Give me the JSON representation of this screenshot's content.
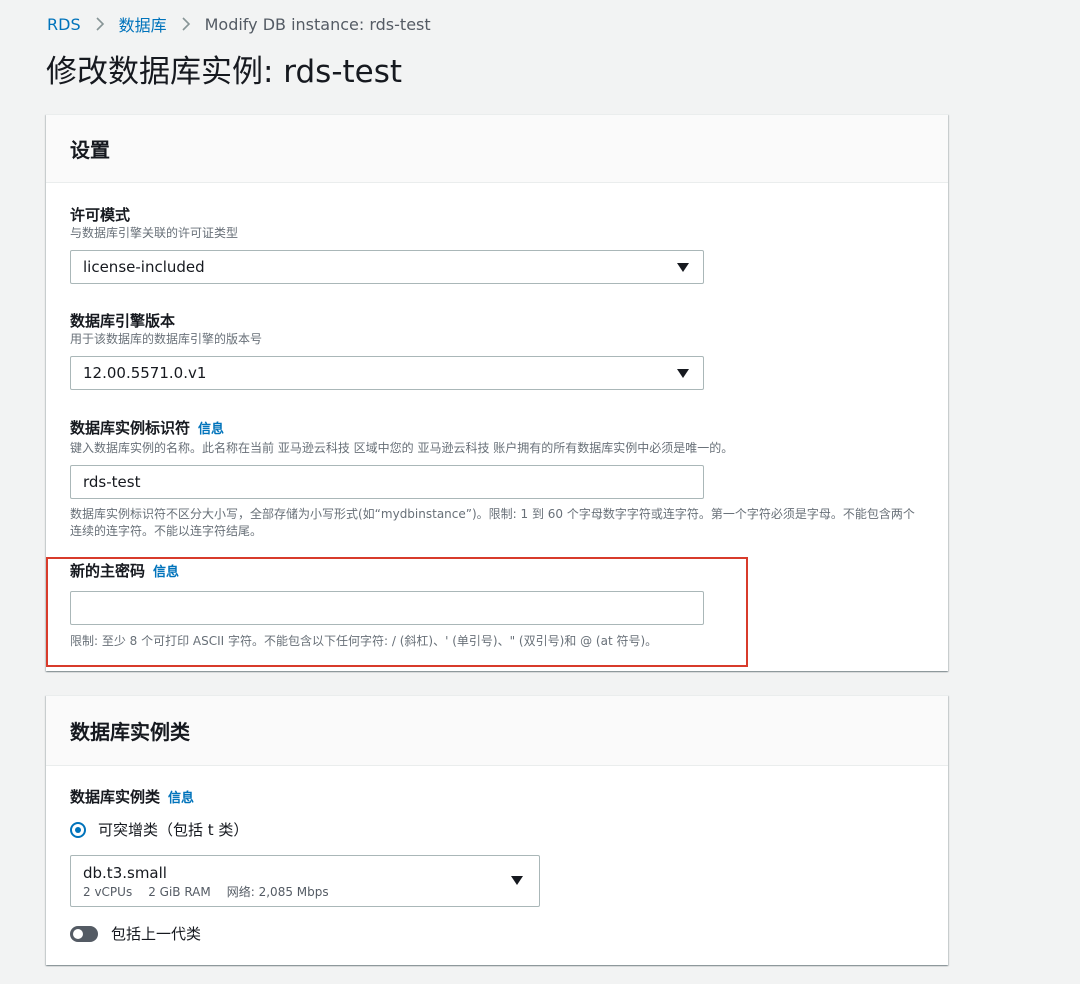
{
  "breadcrumb": {
    "items": [
      "RDS",
      "数据库"
    ],
    "current": "Modify DB instance: rds-test"
  },
  "page": {
    "title": "修改数据库实例: rds-test"
  },
  "settings": {
    "title": "设置",
    "license": {
      "label": "许可模式",
      "desc": "与数据库引擎关联的许可证类型",
      "value": "license-included"
    },
    "engine_version": {
      "label": "数据库引擎版本",
      "desc": "用于该数据库的数据库引擎的版本号",
      "value": "12.00.5571.0.v1"
    },
    "identifier": {
      "label": "数据库实例标识符",
      "info": "信息",
      "desc": "键入数据库实例的名称。此名称在当前 亚马逊云科技 区域中您的 亚马逊云科技 账户拥有的所有数据库实例中必须是唯一的。",
      "value": "rds-test",
      "constraint": "数据库实例标识符不区分大小写，全部存储为小写形式(如“mydbinstance”)。限制: 1 到 60 个字母数字字符或连字符。第一个字符必须是字母。不能包含两个连续的连字符。不能以连字符结尾。"
    },
    "master_password": {
      "label": "新的主密码",
      "info": "信息",
      "value": "",
      "constraint": "限制: 至少 8 个可打印 ASCII 字符。不能包含以下任何字符: / (斜杠)、' (单引号)、\" (双引号)和 @ (at 符号)。"
    }
  },
  "instance_class": {
    "title": "数据库实例类",
    "label": "数据库实例类",
    "info": "信息",
    "radio_label": "可突增类（包括 t 类）",
    "selected": {
      "name": "db.t3.small",
      "vcpus": "2 vCPUs",
      "ram": "2 GiB RAM",
      "network": "网络: 2,085 Mbps"
    },
    "toggle_label": "包括上一代类"
  },
  "colors": {
    "link": "#0073bb",
    "highlight": "#d83b2b",
    "background": "#f2f3f3"
  }
}
